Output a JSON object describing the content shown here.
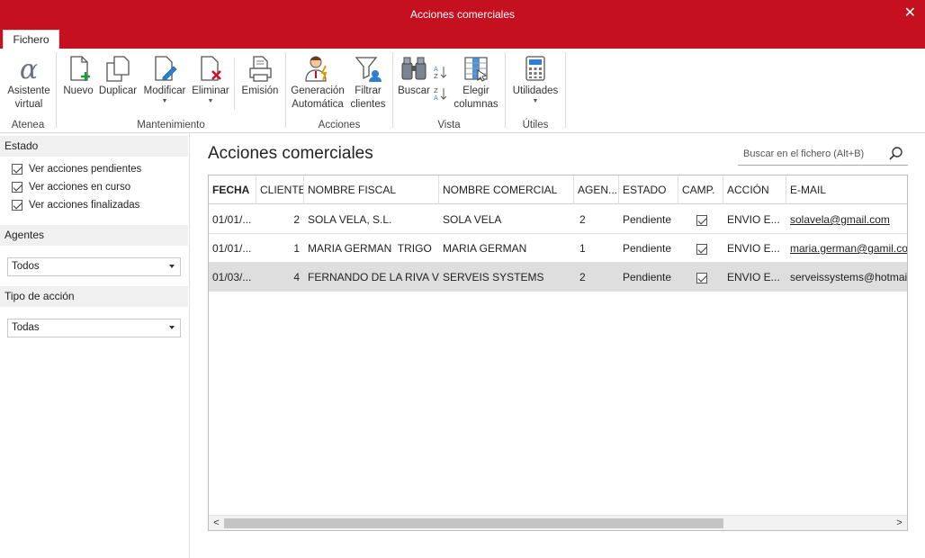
{
  "window": {
    "title": "Acciones comerciales",
    "close_glyph": "✕"
  },
  "tabs": {
    "fichero": "Fichero"
  },
  "ribbon": {
    "groups": {
      "atenea": "Atenea",
      "mantenimiento": "Mantenimiento",
      "acciones": "Acciones",
      "vista": "Vista",
      "utiles": "Útiles"
    },
    "buttons": {
      "asistente_l1": "Asistente",
      "asistente_l2": "virtual",
      "nuevo": "Nuevo",
      "duplicar": "Duplicar",
      "modificar": "Modificar",
      "eliminar": "Eliminar",
      "emision": "Emisión",
      "generacion_l1": "Generación",
      "generacion_l2": "Automática",
      "filtrar_l1": "Filtrar",
      "filtrar_l2": "clientes",
      "buscar": "Buscar",
      "elegir_l1": "Elegir",
      "elegir_l2": "columnas",
      "utilidades": "Utilidades"
    },
    "icons": [
      "alpha-icon",
      "new-doc-icon",
      "duplicate-icon",
      "edit-doc-icon",
      "delete-doc-icon",
      "print-icon",
      "user-bolt-icon",
      "funnel-icon",
      "binoculars-icon",
      "sort-az-icon",
      "sort-za-icon",
      "columns-icon",
      "calculator-icon"
    ]
  },
  "sidebar": {
    "estado": {
      "title": "Estado",
      "options": [
        {
          "label": "Ver acciones pendientes",
          "checked": true
        },
        {
          "label": "Ver acciones en curso",
          "checked": true
        },
        {
          "label": "Ver acciones finalizadas",
          "checked": true
        }
      ]
    },
    "agentes": {
      "title": "Agentes",
      "value": "Todos"
    },
    "tipo": {
      "title": "Tipo de acción",
      "value": "Todas"
    }
  },
  "main": {
    "title": "Acciones comerciales",
    "search_placeholder": "Buscar en el fichero (Alt+B)"
  },
  "table": {
    "columns": [
      "FECHA",
      "CLIENTE",
      "NOMBRE FISCAL",
      "NOMBRE COMERCIAL",
      "AGEN...",
      "ESTADO",
      "CAMP.",
      "ACCIÓN",
      "E-MAIL"
    ],
    "rows": [
      {
        "fecha": "01/01/...",
        "cliente": "2",
        "nombre_fiscal": "SOLA VELA, S.L.",
        "nombre_comercial": "SOLA VELA",
        "agente": "2",
        "estado": "Pendiente",
        "camp": true,
        "accion": "ENVIO E...",
        "email": "solavela@gmail.com",
        "selected": false
      },
      {
        "fecha": "01/01/...",
        "cliente": "1",
        "nombre_fiscal": "MARIA GERMAN  TRIGO",
        "nombre_comercial": "MARIA GERMAN",
        "agente": "1",
        "estado": "Pendiente",
        "camp": true,
        "accion": "ENVIO E...",
        "email": "maria.german@gamil.co",
        "selected": false
      },
      {
        "fecha": "01/03/...",
        "cliente": "4",
        "nombre_fiscal": "FERNANDO DE LA RIVA V...",
        "nombre_comercial": "SERVEIS SYSTEMS",
        "agente": "2",
        "estado": "Pendiente",
        "camp": true,
        "accion": "ENVIO E...",
        "email": "serveissystems@hotmail.",
        "selected": true
      }
    ]
  },
  "scrollbar": {
    "left_arrow": "<",
    "right_arrow": ">"
  },
  "colors": {
    "brand": "#c5101f",
    "selected_row": "#dedede"
  }
}
